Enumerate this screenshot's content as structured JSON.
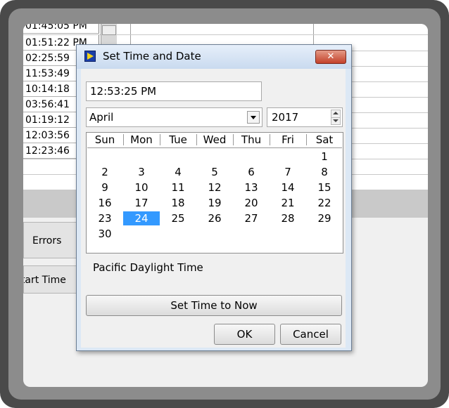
{
  "background": {
    "times": [
      "01:45:05 PM",
      "01:51:22 PM",
      "02:25:59",
      "11:53:49",
      "10:14:18",
      "03:56:41",
      "01:19:12",
      "12:03:56",
      "12:23:46"
    ],
    "errors_tab": "Errors",
    "start_time_tab": "Start Time"
  },
  "dialog": {
    "title": "Set Time and Date",
    "close_label": "✕",
    "time_value": "12:53:25 PM",
    "month": "April",
    "year": "2017",
    "day_headers": [
      "Sun",
      "Mon",
      "Tue",
      "Wed",
      "Thu",
      "Fri",
      "Sat"
    ],
    "days": [
      "1",
      "2",
      "3",
      "4",
      "5",
      "6",
      "7",
      "8",
      "9",
      "10",
      "11",
      "12",
      "13",
      "14",
      "15",
      "16",
      "17",
      "18",
      "19",
      "20",
      "21",
      "22",
      "23",
      "24",
      "25",
      "26",
      "27",
      "28",
      "29",
      "30"
    ],
    "selected_day": "24",
    "timezone": "Pacific Daylight Time",
    "set_now_label": "Set Time to Now",
    "ok_label": "OK",
    "cancel_label": "Cancel"
  },
  "colors": {
    "selection": "#3399ff",
    "close_button": "#c3412a",
    "frame": "#4a4a4a"
  }
}
